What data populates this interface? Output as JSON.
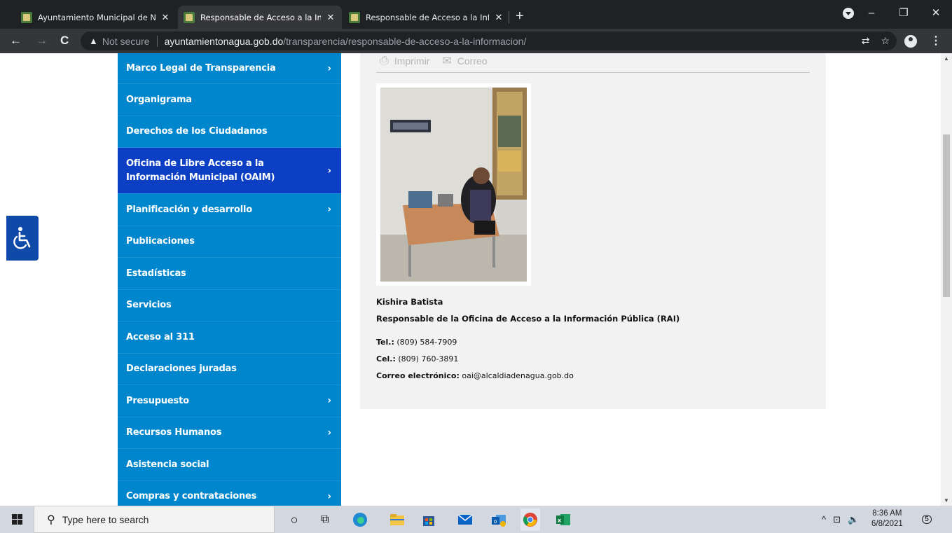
{
  "browser": {
    "tabs": [
      {
        "title": "Ayuntamiento Municipal de Nagua",
        "active": false
      },
      {
        "title": "Responsable de Acceso a la Información",
        "active": true
      },
      {
        "title": "Responsable de Acceso a la Información",
        "active": false
      }
    ],
    "new_tab_label": "+",
    "address": {
      "security_label": "Not secure",
      "host": "ayuntamientonagua.gob.do",
      "path": "/transparencia/responsable-de-acceso-a-la-informacion/"
    }
  },
  "sidebar": {
    "items": [
      {
        "label": "Marco Legal de Transparencia",
        "has_submenu": true
      },
      {
        "label": "Organigrama",
        "has_submenu": false
      },
      {
        "label": "Derechos de los Ciudadanos",
        "has_submenu": false
      },
      {
        "label": "Oficina de Libre Acceso a la Información Municipal (OAIM)",
        "has_submenu": true,
        "active": true
      },
      {
        "label": "Planificación y desarrollo",
        "has_submenu": true
      },
      {
        "label": "Publicaciones",
        "has_submenu": false
      },
      {
        "label": "Estadísticas",
        "has_submenu": false
      },
      {
        "label": "Servicios",
        "has_submenu": false
      },
      {
        "label": "Acceso al 311",
        "has_submenu": false
      },
      {
        "label": "Declaraciones juradas",
        "has_submenu": false
      },
      {
        "label": "Presupuesto",
        "has_submenu": true
      },
      {
        "label": "Recursos Humanos",
        "has_submenu": true
      },
      {
        "label": "Asistencia social",
        "has_submenu": false
      },
      {
        "label": "Compras y contrataciones",
        "has_submenu": true
      }
    ],
    "submenu_glyph": "›",
    "colors": {
      "menu": "#0086cc",
      "active": "#0d3fc4"
    }
  },
  "share": {
    "print_label": "Imprimir",
    "email_label": "Correo"
  },
  "contact": {
    "name": "Kishira Batista",
    "role": "Responsable de la Oficina de Acceso a la Información Pública (RAI)",
    "tel_label": "Tel.:",
    "tel_value": " (809) 584-7909",
    "cel_label": "Cel.:",
    "cel_value": " (809) 760-3891",
    "email_label": "Correo electrónico:",
    "email_value": " oai@alcaldiadenagua.gob.do"
  },
  "taskbar": {
    "search_placeholder": "Type here to search",
    "time": "8:36 AM",
    "date": "6/8/2021",
    "notification_count": "5"
  }
}
